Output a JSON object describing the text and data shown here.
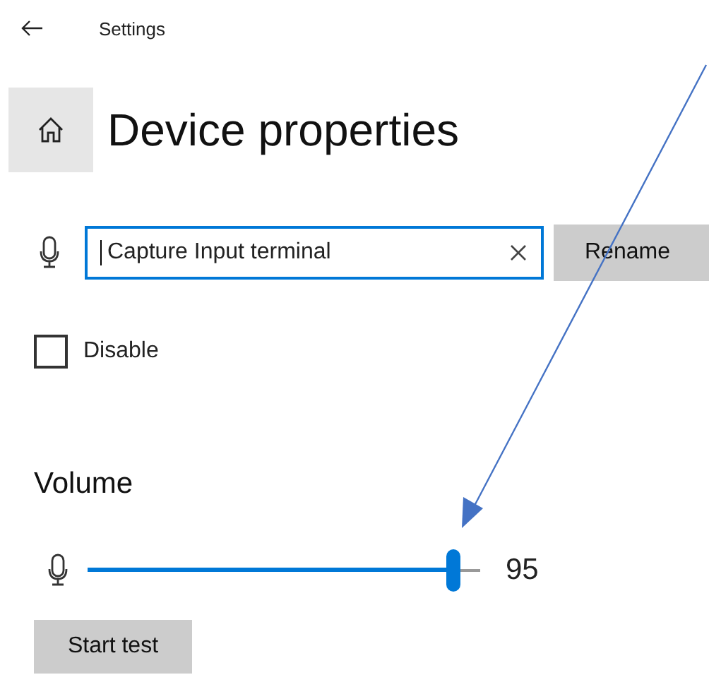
{
  "header": {
    "title": "Settings"
  },
  "page_title": "Device properties",
  "name_field": {
    "value": "Capture Input terminal",
    "focused": true
  },
  "rename_button": "Rename",
  "disable_checkbox": {
    "label": "Disable",
    "checked": false
  },
  "volume": {
    "heading": "Volume",
    "level": 0.93,
    "reading": "95"
  },
  "start_test_button": "Start test"
}
